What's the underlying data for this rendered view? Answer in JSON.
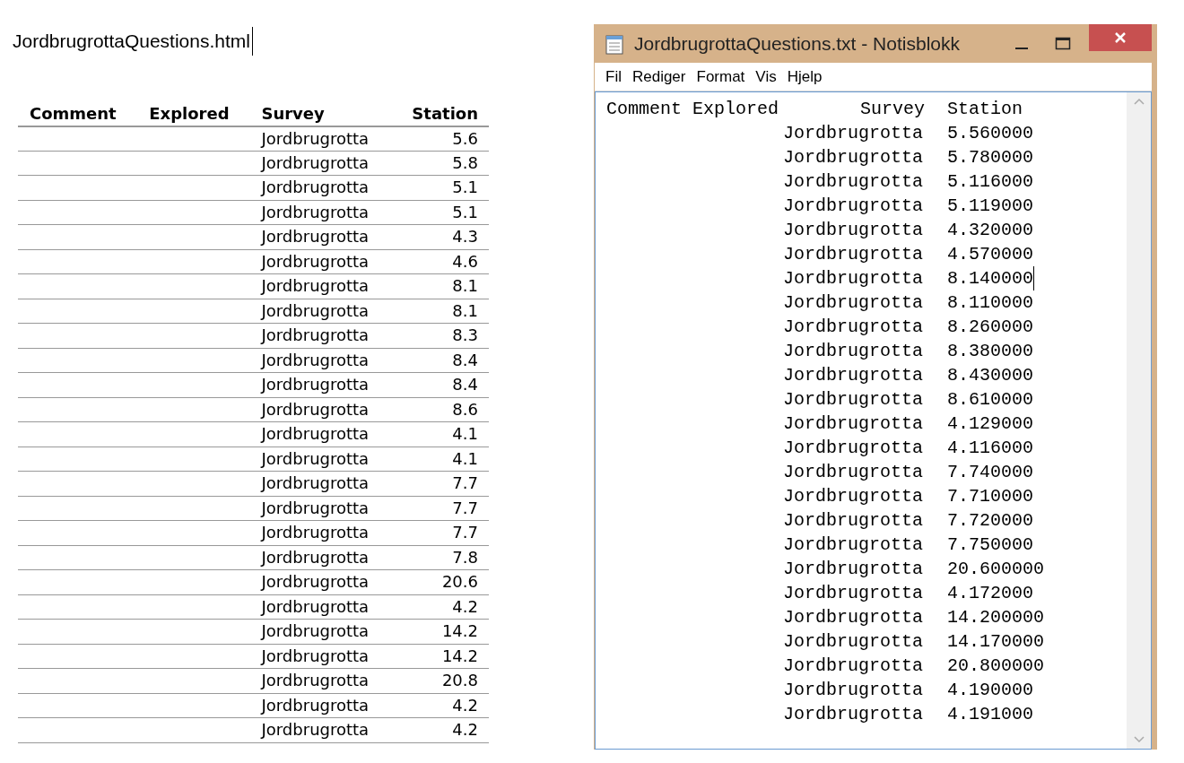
{
  "file_label": {
    "text": "JordbrugrottaQuestions.html",
    "cursor": true
  },
  "table": {
    "columns": [
      "Comment",
      "Explored",
      "Survey",
      "Station"
    ],
    "rows": [
      {
        "survey": "Jordbrugrotta",
        "station": "5.6"
      },
      {
        "survey": "Jordbrugrotta",
        "station": "5.8"
      },
      {
        "survey": "Jordbrugrotta",
        "station": "5.1"
      },
      {
        "survey": "Jordbrugrotta",
        "station": "5.1"
      },
      {
        "survey": "Jordbrugrotta",
        "station": "4.3"
      },
      {
        "survey": "Jordbrugrotta",
        "station": "4.6"
      },
      {
        "survey": "Jordbrugrotta",
        "station": "8.1"
      },
      {
        "survey": "Jordbrugrotta",
        "station": "8.1"
      },
      {
        "survey": "Jordbrugrotta",
        "station": "8.3"
      },
      {
        "survey": "Jordbrugrotta",
        "station": "8.4"
      },
      {
        "survey": "Jordbrugrotta",
        "station": "8.4"
      },
      {
        "survey": "Jordbrugrotta",
        "station": "8.6"
      },
      {
        "survey": "Jordbrugrotta",
        "station": "4.1"
      },
      {
        "survey": "Jordbrugrotta",
        "station": "4.1"
      },
      {
        "survey": "Jordbrugrotta",
        "station": "7.7"
      },
      {
        "survey": "Jordbrugrotta",
        "station": "7.7"
      },
      {
        "survey": "Jordbrugrotta",
        "station": "7.7"
      },
      {
        "survey": "Jordbrugrotta",
        "station": "7.8"
      },
      {
        "survey": "Jordbrugrotta",
        "station": "20.6"
      },
      {
        "survey": "Jordbrugrotta",
        "station": "4.2"
      },
      {
        "survey": "Jordbrugrotta",
        "station": "14.2"
      },
      {
        "survey": "Jordbrugrotta",
        "station": "14.2"
      },
      {
        "survey": "Jordbrugrotta",
        "station": "20.8"
      },
      {
        "survey": "Jordbrugrotta",
        "station": "4.2"
      },
      {
        "survey": "Jordbrugrotta",
        "station": "4.2"
      }
    ]
  },
  "notepad": {
    "window": {
      "title": "JordbrugrottaQuestions.txt - Notisblokk"
    },
    "menu": [
      "Fil",
      "Rediger",
      "Format",
      "Vis",
      "Hjelp"
    ],
    "header": {
      "left": "Comment Explored",
      "survey": "Survey",
      "station": "Station"
    },
    "rows": [
      {
        "survey": "Jordbrugrotta",
        "station": "5.560000",
        "cursor": false
      },
      {
        "survey": "Jordbrugrotta",
        "station": "5.780000",
        "cursor": false
      },
      {
        "survey": "Jordbrugrotta",
        "station": "5.116000",
        "cursor": false
      },
      {
        "survey": "Jordbrugrotta",
        "station": "5.119000",
        "cursor": false
      },
      {
        "survey": "Jordbrugrotta",
        "station": "4.320000",
        "cursor": false
      },
      {
        "survey": "Jordbrugrotta",
        "station": "4.570000",
        "cursor": false
      },
      {
        "survey": "Jordbrugrotta",
        "station": "8.140000",
        "cursor": true
      },
      {
        "survey": "Jordbrugrotta",
        "station": "8.110000",
        "cursor": false
      },
      {
        "survey": "Jordbrugrotta",
        "station": "8.260000",
        "cursor": false
      },
      {
        "survey": "Jordbrugrotta",
        "station": "8.380000",
        "cursor": false
      },
      {
        "survey": "Jordbrugrotta",
        "station": "8.430000",
        "cursor": false
      },
      {
        "survey": "Jordbrugrotta",
        "station": "8.610000",
        "cursor": false
      },
      {
        "survey": "Jordbrugrotta",
        "station": "4.129000",
        "cursor": false
      },
      {
        "survey": "Jordbrugrotta",
        "station": "4.116000",
        "cursor": false
      },
      {
        "survey": "Jordbrugrotta",
        "station": "7.740000",
        "cursor": false
      },
      {
        "survey": "Jordbrugrotta",
        "station": "7.710000",
        "cursor": false
      },
      {
        "survey": "Jordbrugrotta",
        "station": "7.720000",
        "cursor": false
      },
      {
        "survey": "Jordbrugrotta",
        "station": "7.750000",
        "cursor": false
      },
      {
        "survey": "Jordbrugrotta",
        "station": "20.600000",
        "cursor": false
      },
      {
        "survey": "Jordbrugrotta",
        "station": "4.172000",
        "cursor": false
      },
      {
        "survey": "Jordbrugrotta",
        "station": "14.200000",
        "cursor": false
      },
      {
        "survey": "Jordbrugrotta",
        "station": "14.170000",
        "cursor": false
      },
      {
        "survey": "Jordbrugrotta",
        "station": "20.800000",
        "cursor": false
      },
      {
        "survey": "Jordbrugrotta",
        "station": "4.190000",
        "cursor": false
      },
      {
        "survey": "Jordbrugrotta",
        "station": "4.191000",
        "cursor": false
      }
    ]
  }
}
